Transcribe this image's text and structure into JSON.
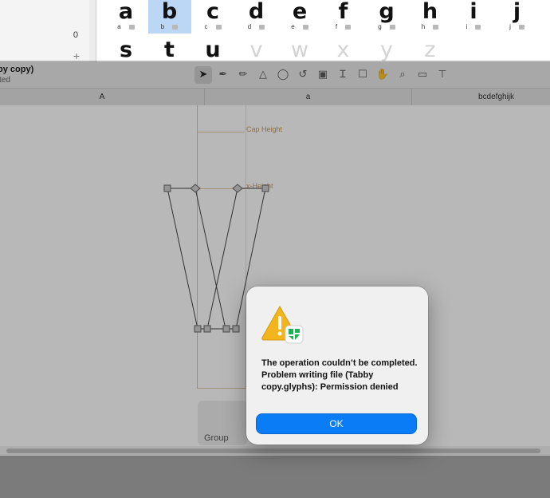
{
  "glyphs": {
    "row1": [
      {
        "char": "a",
        "sub": "a"
      },
      {
        "char": "b",
        "sub": "b",
        "selected": true
      },
      {
        "char": "c",
        "sub": "c"
      },
      {
        "char": "d",
        "sub": "d"
      },
      {
        "char": "e",
        "sub": "e"
      },
      {
        "char": "f",
        "sub": "f"
      },
      {
        "char": "g",
        "sub": "g"
      },
      {
        "char": "h",
        "sub": "h"
      },
      {
        "char": "i",
        "sub": "i"
      },
      {
        "char": "j",
        "sub": "j"
      }
    ],
    "row2": [
      {
        "char": "s"
      },
      {
        "char": "t"
      },
      {
        "char": "u"
      },
      {
        "char": "v",
        "empty": true
      },
      {
        "char": "w",
        "empty": true
      },
      {
        "char": "x",
        "empty": true
      },
      {
        "char": "y",
        "empty": true
      },
      {
        "char": "z",
        "empty": true
      }
    ]
  },
  "sidebar": {
    "count": "0",
    "add_icon": "+"
  },
  "window": {
    "title": "by copy)",
    "subtitle": "ted"
  },
  "toolbar": {
    "tools": [
      "select-tool-icon",
      "pen-tool-icon",
      "pencil-tool-icon",
      "primitives-tool-icon",
      "rotate-tool-icon",
      "undo-tool-icon",
      "component-tool-icon",
      "text-tool-icon",
      "annotation-tool-icon",
      "hand-tool-icon",
      "zoom-tool-icon",
      "measure-tool-icon",
      "anchor-tool-icon"
    ],
    "glyphs": [
      "➤",
      "✒",
      "✏",
      "△",
      "◯",
      "↺",
      "▣",
      "Ɪ",
      "☐",
      "✋",
      "⌕",
      "▭",
      "⊤"
    ]
  },
  "tabs": [
    "A",
    "a",
    "bcdefghijk"
  ],
  "metrics": {
    "cap_height": "Cap Height",
    "x_height": "x-Height"
  },
  "panel": {
    "group_label": "Group"
  },
  "alert": {
    "message": "The operation couldn’t be completed. Problem writing file (Tabby copy.glyphs): Permission denied",
    "ok_label": "OK",
    "warning_color": "#f2b51d",
    "app_badge_color": "#1db254",
    "button_color": "#0a7cf6"
  }
}
